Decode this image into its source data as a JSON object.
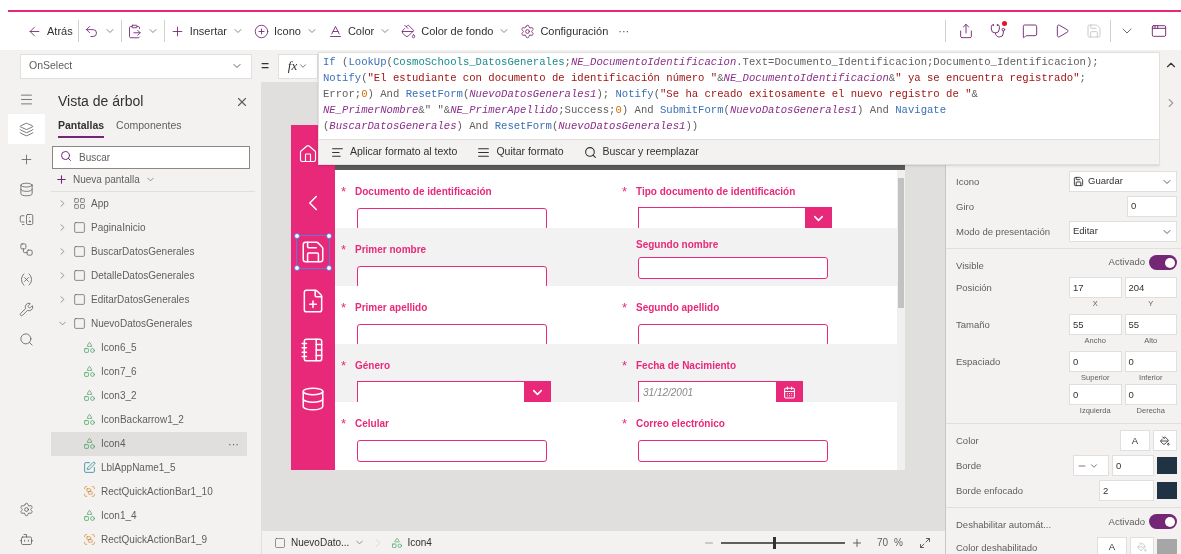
{
  "toolbar": {
    "left": [
      {
        "kind": "back",
        "label": "Atrás",
        "caret": false
      },
      {
        "kind": "undo",
        "caret": true
      },
      {
        "kind": "paste",
        "caret": true
      },
      {
        "kind": "insert",
        "label": "Insertar",
        "caret": true
      },
      {
        "kind": "icon",
        "label": "Icono",
        "caret": true
      },
      {
        "kind": "color",
        "label": "Color",
        "caret": true
      },
      {
        "kind": "fill",
        "label": "Color de fondo",
        "caret": true
      },
      {
        "kind": "settings",
        "label": "Configuración",
        "caret": false
      },
      {
        "kind": "more",
        "label": "···",
        "caret": false
      }
    ],
    "right": [
      {
        "kind": "share",
        "notification": false,
        "disabled": false
      },
      {
        "kind": "checker",
        "notification": true,
        "disabled": false
      },
      {
        "kind": "comment",
        "notification": false,
        "disabled": false
      },
      {
        "kind": "play",
        "notification": false,
        "disabled": false
      },
      {
        "kind": "save",
        "notification": false,
        "disabled": true
      },
      {
        "kind": "caret",
        "notification": false,
        "disabled": false
      },
      {
        "kind": "publish",
        "notification": false,
        "disabled": false
      }
    ]
  },
  "formula_bar": {
    "property": "OnSelect",
    "equals": "=",
    "fx": "fx",
    "lines": [
      [
        {
          "text": "If",
          "kind": "fn"
        },
        {
          "text": " (",
          "kind": "p"
        },
        {
          "text": "LookUp",
          "kind": "fn"
        },
        {
          "text": "(",
          "kind": "p"
        },
        {
          "text": "CosmoSchools_DatosGenerales",
          "kind": "src"
        },
        {
          "text": ";",
          "kind": "p"
        },
        {
          "text": "NE_DocumentoIdentificacion",
          "kind": "var"
        },
        {
          "text": ".Text=Documento_Identificacion;Documento_Identificacion);",
          "kind": "p"
        }
      ],
      [
        {
          "text": "Notify",
          "kind": "fn"
        },
        {
          "text": "(",
          "kind": "p"
        },
        {
          "text": "\"El estudiante con documento de identificación número \"",
          "kind": "str"
        },
        {
          "text": "&",
          "kind": "p"
        },
        {
          "text": "NE_DocumentoIdentificacion",
          "kind": "var"
        },
        {
          "text": "&",
          "kind": "p"
        },
        {
          "text": "\" ya se encuentra registrado\"",
          "kind": "str"
        },
        {
          "text": ";",
          "kind": "p"
        }
      ],
      [
        {
          "text": "Error;",
          "kind": "p"
        },
        {
          "text": "0",
          "kind": "num"
        },
        {
          "text": ") And ",
          "kind": "p"
        },
        {
          "text": "ResetForm",
          "kind": "fn"
        },
        {
          "text": "(",
          "kind": "p"
        },
        {
          "text": "NuevoDatosGenerales1",
          "kind": "var"
        },
        {
          "text": "); ",
          "kind": "p"
        },
        {
          "text": "Notify",
          "kind": "fn"
        },
        {
          "text": "(",
          "kind": "p"
        },
        {
          "text": "\"Se ha creado exitosamente el nuevo registro de \"",
          "kind": "str"
        },
        {
          "text": "&",
          "kind": "p"
        }
      ],
      [
        {
          "text": "NE_PrimerNombre",
          "kind": "var"
        },
        {
          "text": "&\" \"&",
          "kind": "p"
        },
        {
          "text": "NE_PrimerApellido",
          "kind": "var"
        },
        {
          "text": ";Success;",
          "kind": "p"
        },
        {
          "text": "0",
          "kind": "num"
        },
        {
          "text": ") And ",
          "kind": "p"
        },
        {
          "text": "SubmitForm",
          "kind": "fn"
        },
        {
          "text": "(",
          "kind": "p"
        },
        {
          "text": "NuevoDatosGenerales1",
          "kind": "var"
        },
        {
          "text": ") And ",
          "kind": "p"
        },
        {
          "text": "Navigate",
          "kind": "fn"
        }
      ],
      [
        {
          "text": "(",
          "kind": "p"
        },
        {
          "text": "BuscarDatosGenerales",
          "kind": "var"
        },
        {
          "text": ") And ",
          "kind": "p"
        },
        {
          "text": "ResetForm",
          "kind": "fn"
        },
        {
          "text": "(",
          "kind": "p"
        },
        {
          "text": "NuevoDatosGenerales1",
          "kind": "var"
        },
        {
          "text": "))",
          "kind": "p"
        }
      ]
    ],
    "format_actions": [
      {
        "kind": "format",
        "label": "Aplicar formato al texto"
      },
      {
        "kind": "clear",
        "label": "Quitar formato"
      },
      {
        "kind": "find",
        "label": "Buscar y reemplazar"
      }
    ]
  },
  "rail": [
    {
      "kind": "menu",
      "selected": false
    },
    {
      "kind": "tree",
      "selected": true
    },
    {
      "kind": "insert",
      "selected": false
    },
    {
      "kind": "data",
      "selected": false
    },
    {
      "kind": "media",
      "selected": false
    },
    {
      "kind": "automate",
      "selected": false
    },
    {
      "kind": "variables",
      "selected": false
    },
    {
      "kind": "tools",
      "selected": false
    },
    {
      "kind": "search",
      "selected": false
    }
  ],
  "rail_bottom": [
    {
      "kind": "settings",
      "selected": false
    },
    {
      "kind": "agent",
      "selected": false
    }
  ],
  "tree_view": {
    "title": "Vista de árbol",
    "tabs": [
      {
        "label": "Pantallas",
        "selected": true
      },
      {
        "label": "Componentes",
        "selected": false
      }
    ],
    "search": {
      "placeholder": "Buscar"
    },
    "new_screen": "Nueva pantalla",
    "items": [
      {
        "kind": "app",
        "label": "App",
        "expanded": false,
        "selected": false
      },
      {
        "kind": "screen",
        "label": "PaginaInicio",
        "expanded": false,
        "selected": false
      },
      {
        "kind": "screen",
        "label": "BuscarDatosGenerales",
        "expanded": false,
        "selected": false
      },
      {
        "kind": "screen",
        "label": "DetalleDatosGenerales",
        "expanded": false,
        "selected": false
      },
      {
        "kind": "screen",
        "label": "EditarDatosGenerales",
        "expanded": false,
        "selected": false
      },
      {
        "kind": "screen",
        "label": "NuevoDatosGenerales",
        "expanded": true,
        "selected": false,
        "children": [
          {
            "kind": "icon",
            "label": "Icon6_5",
            "selected": false
          },
          {
            "kind": "icon",
            "label": "Icon7_6",
            "selected": false
          },
          {
            "kind": "icon",
            "label": "Icon3_2",
            "selected": false
          },
          {
            "kind": "icon",
            "label": "IconBackarrow1_2",
            "selected": false
          },
          {
            "kind": "icon",
            "label": "Icon4",
            "selected": true,
            "more": "···"
          },
          {
            "kind": "label",
            "label": "LblAppName1_5",
            "selected": false
          },
          {
            "kind": "rect",
            "label": "RectQuickActionBar1_10",
            "selected": false
          },
          {
            "kind": "icon",
            "label": "Icon1_4",
            "selected": false
          },
          {
            "kind": "rect",
            "label": "RectQuickActionBar1_9",
            "selected": false
          }
        ]
      }
    ]
  },
  "app_screen": {
    "sidebar": [
      {
        "kind": "home",
        "selected": false
      },
      {
        "kind": "back",
        "selected": false
      },
      {
        "kind": "save",
        "selected": true
      },
      {
        "kind": "new",
        "selected": false
      },
      {
        "kind": "notebook",
        "selected": false
      },
      {
        "kind": "database",
        "selected": false
      }
    ],
    "rows": [
      [
        {
          "mark": "*",
          "label": "Documento de identificación",
          "kind": "text"
        },
        {
          "mark": "*",
          "label": "Tipo documento de identificación",
          "kind": "dropdown"
        }
      ],
      [
        {
          "mark": "*",
          "label": "Primer nombre",
          "kind": "text"
        },
        {
          "label": "Segundo nombre",
          "kind": "text"
        }
      ],
      [
        {
          "mark": "*",
          "label": "Primer apellido",
          "kind": "text"
        },
        {
          "mark": "*",
          "label": "Segundo apellido",
          "kind": "text"
        }
      ],
      [
        {
          "mark": "*",
          "label": "Género",
          "kind": "dropdown"
        },
        {
          "mark": "*",
          "label": "Fecha de Nacimiento",
          "kind": "date",
          "placeholder": "31/12/2001"
        }
      ],
      [
        {
          "mark": "*",
          "label": "Celular",
          "kind": "text"
        },
        {
          "mark": "*",
          "label": "Correo electrónico",
          "kind": "text"
        }
      ]
    ]
  },
  "status_bar": {
    "screen": "NuevoDato...",
    "control": "Icon4",
    "zoom_slider": {
      "level": 0.42
    },
    "zoom": "70",
    "percent": "%"
  },
  "properties": [
    [
      {
        "kind": "icon-select",
        "label": "Icono",
        "value": "Guardar"
      },
      {
        "kind": "number",
        "label": "Giro",
        "value": "0"
      },
      {
        "kind": "select",
        "label": "Modo de presentación",
        "value": "Editar"
      }
    ],
    [
      {
        "kind": "toggle",
        "label": "Visible",
        "state": "Activado",
        "on": true
      },
      {
        "kind": "pair",
        "label": "Posición",
        "fields": [
          {
            "value": "17",
            "caption": "X"
          },
          {
            "value": "204",
            "caption": "Y"
          }
        ]
      },
      {
        "kind": "pair",
        "label": "Tamaño",
        "fields": [
          {
            "value": "55",
            "caption": "Ancho"
          },
          {
            "value": "55",
            "caption": "Alto"
          }
        ]
      },
      {
        "kind": "pair",
        "label": "Espaciado",
        "fields": [
          {
            "value": "0",
            "caption": "Superior"
          },
          {
            "value": "0",
            "caption": "Inferior"
          },
          {
            "value": "0",
            "caption": "Izquierda"
          },
          {
            "value": "0",
            "caption": "Derecha"
          }
        ]
      }
    ],
    [
      {
        "kind": "color",
        "label": "Color",
        "text": "A",
        "disabled": false
      },
      {
        "kind": "border",
        "label": "Borde",
        "value": "0",
        "color": "#1f3344"
      },
      {
        "kind": "focus-border",
        "label": "Borde enfocado",
        "value": "2",
        "color": "#1f3344"
      }
    ],
    [
      {
        "kind": "toggle",
        "label": "Deshabilitar automát...",
        "state": "Activado",
        "on": true
      },
      {
        "kind": "color",
        "label": "Color deshabilitado",
        "text": "A",
        "disabled": true,
        "color": "#a6a6a6"
      }
    ]
  ]
}
